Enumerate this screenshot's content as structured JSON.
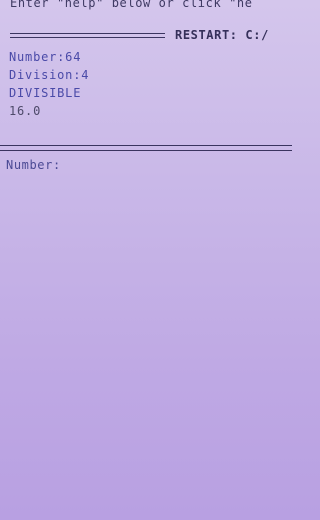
{
  "console": {
    "banner_text": "Enter \"help\" below or click \"he",
    "restart_text": "RESTART: C:/",
    "output_lines": [
      {
        "text": "Number:64",
        "tone": "blue"
      },
      {
        "text": "Division:4",
        "tone": "blue"
      },
      {
        "text": "DIVISIBLE",
        "tone": "blue"
      },
      {
        "text": "16.0",
        "tone": "gray"
      }
    ],
    "prompt_label": "Number:",
    "input_value": ""
  },
  "colors": {
    "background": "#c9b8e8",
    "output_blue": "#4a4aa8",
    "result_gray": "#4e4a6a",
    "rule": "#3a345f"
  }
}
